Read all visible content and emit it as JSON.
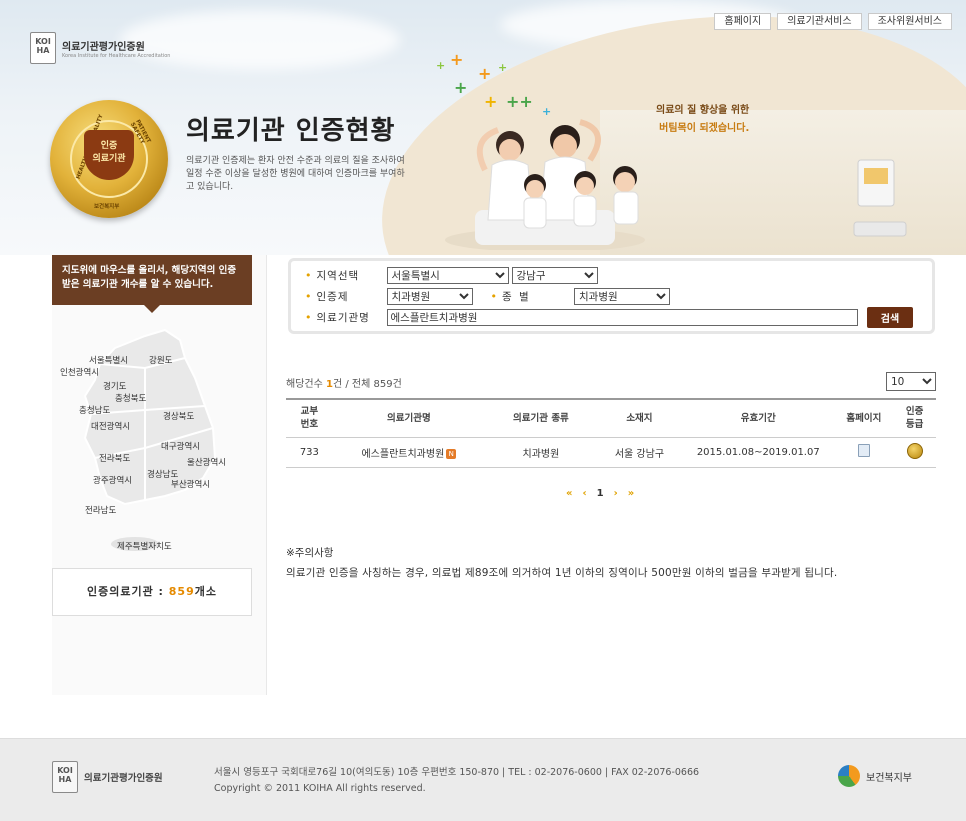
{
  "topnav": [
    "홈페이지",
    "의료기관서비스",
    "조사위원서비스"
  ],
  "logo": {
    "name_ko": "의료기관평가인증원",
    "name_en": "Korea Institute for Healthcare Accreditation",
    "mark": "KOIHA"
  },
  "medal": {
    "line1": "인증",
    "line2": "의료기관",
    "ring_left": "HEALTHCARE QUALITY",
    "ring_right": "PATIENT SAFETY",
    "ring_bottom": "보건복지부"
  },
  "header": {
    "title": "의료기관 인증현황",
    "description": "의료기관 인증제는 환자 안전 수준과 의료의 질을 조사하여 일정 수준 이상을 달성한 병원에 대하여 인증마크를 부여하고 있습니다.",
    "slogan_line1": "의료의 질 향상을 위한",
    "slogan_line2": "버팀목이 되겠습니다."
  },
  "sidebar": {
    "banner": "지도위에 마우스를 올리서, 해당지역의 인증 받은 의료기관 개수를 알 수 있습니다.",
    "regions": [
      "서울특별시",
      "강원도",
      "인천광역시",
      "경기도",
      "충청북도",
      "충청남도",
      "경상북도",
      "대전광역시",
      "대구광역시",
      "전라북도",
      "울산광역시",
      "광주광역시",
      "경상남도",
      "부산광역시",
      "전라남도",
      "제주특별자치도"
    ],
    "count_label": "인증의료기관 :",
    "count_value": "859",
    "count_unit": "개소"
  },
  "search": {
    "region_label": "지역선택",
    "region_value": "서울특별시",
    "district_value": "강남구",
    "cert_label": "인증제",
    "cert_value": "치과병원",
    "type_label": "종  별",
    "type_value": "치과병원",
    "name_label": "의료기관명",
    "name_value": "에스플란트치과병원",
    "button": "검색"
  },
  "results": {
    "count_prefix": "해당건수 ",
    "count": "1",
    "count_mid": "건 / 전체 ",
    "total": "859",
    "total_suffix": "건",
    "page_size": "10",
    "headers": [
      "교부\n번호",
      "의료기관명",
      "의료기관 종류",
      "소재지",
      "유효기간",
      "홈페이지",
      "인증\n등급"
    ],
    "rows": [
      {
        "no": "733",
        "name": "에스플란트치과병원",
        "kind": "치과병원",
        "location": "서울 강남구",
        "period": "2015.01.08~2019.01.07"
      }
    ]
  },
  "pager": {
    "first": "«",
    "prev": "‹",
    "current": "1",
    "next": "›",
    "last": "»"
  },
  "notice": {
    "title": "※주의사항",
    "text": "의료기관 인증을 사칭하는 경우, 의료법 제89조에 의거하여 1년 이하의 징역이나 500만원 이하의 벌금을 부과받게 됩니다."
  },
  "footer": {
    "org": "의료기관평가인증원",
    "address": "서울시 영등포구 국회대로76길 10(여의도동) 10층 우편번호 150-870 | TEL : 02-2076-0600 | FAX 02-2076-0666",
    "copyright": "Copyright © 2011 KOIHA All rights reserved.",
    "ministry": "보건복지부"
  },
  "colors": {
    "brown": "#6b3e23",
    "accent": "#e58a00",
    "search_button": "#6b2f12"
  }
}
